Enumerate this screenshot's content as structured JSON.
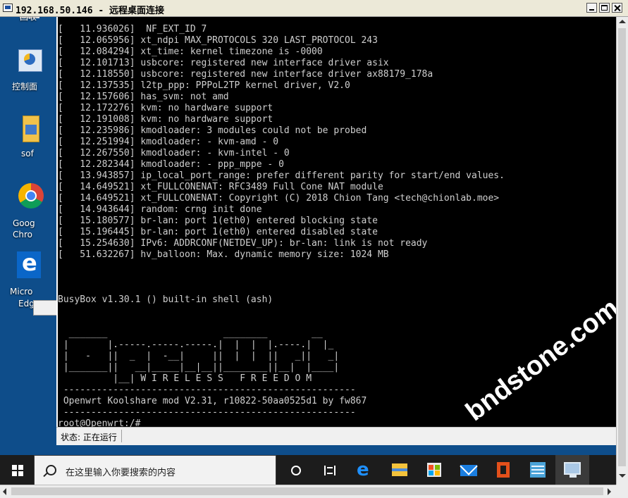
{
  "window": {
    "title": "192.168.50.146 - 远程桌面连接"
  },
  "desktop": {
    "icons": [
      {
        "label": "回收"
      },
      {
        "label": "控制面"
      },
      {
        "label": "sof"
      },
      {
        "label": "Goog"
      },
      {
        "label": "Chro"
      },
      {
        "label": "Micro"
      },
      {
        "label": "Edg"
      }
    ]
  },
  "terminal": {
    "lines": [
      "[   11.936026]  NF_EXT_ID 7",
      "[   12.065956] xt_ndpi MAX_PROTOCOLS 320 LAST_PROTOCOL 243",
      "[   12.084294] xt_time: kernel timezone is -0000",
      "[   12.101713] usbcore: registered new interface driver asix",
      "[   12.118550] usbcore: registered new interface driver ax88179_178a",
      "[   12.137535] l2tp_ppp: PPPoL2TP kernel driver, V2.0",
      "[   12.157606] has_svm: not amd",
      "[   12.172276] kvm: no hardware support",
      "[   12.191008] kvm: no hardware support",
      "[   12.235986] kmodloader: 3 modules could not be probed",
      "[   12.251994] kmodloader: - kvm-amd - 0",
      "[   12.267550] kmodloader: - kvm-intel - 0",
      "[   12.282344] kmodloader: - ppp_mppe - 0",
      "[   13.943857] ip_local_port_range: prefer different parity for start/end values.",
      "[   14.649521] xt_FULLCONENAT: RFC3489 Full Cone NAT module",
      "[   14.649521] xt_FULLCONENAT: Copyright (C) 2018 Chion Tang <tech@chionlab.moe>",
      "[   14.943644] random: crng init done",
      "[   15.180577] br-lan: port 1(eth0) entered blocking state",
      "[   15.196445] br-lan: port 1(eth0) entered disabled state",
      "[   15.254630] IPv6: ADDRCONF(NETDEV_UP): br-lan: link is not ready",
      "[   51.632267] hv_balloon: Max. dynamic memory size: 1024 MB",
      "",
      "",
      "",
      "BusyBox v1.30.1 () built-in shell (ash)",
      "",
      "",
      "  _______                     ________        __",
      " |       |.-----.-----.-----.|  |  |  |.----.|  |_",
      " |   -   ||  _  |  -__|     ||  |  |  ||   _||   _|",
      " |_______||   __|_____|__|__||________||__|  |____|",
      "          |__| W I R E L E S S   F R E E D O M",
      " -----------------------------------------------------",
      " Openwrt Koolshare mod V2.31, r10822-50aa0525d1 by fw867",
      " -----------------------------------------------------",
      "root@Openwrt:/#",
      "root@Openwrt:/#"
    ]
  },
  "statusbar": {
    "text": "状态: 正在运行"
  },
  "watermark": {
    "text": "bndstone.com"
  },
  "taskbar": {
    "search_placeholder": "在这里输入你要搜索的内容",
    "icons": [
      "task-view",
      "timeline",
      "edge",
      "file-explorer",
      "store",
      "mail",
      "office",
      "server-manager",
      "remote-desktop"
    ]
  },
  "colors": {
    "terminal_bg": "#000000",
    "terminal_fg": "#cfcfcf",
    "desktop_bg": "#0e4d8a",
    "taskbar_bg": "#1c1c1c"
  }
}
